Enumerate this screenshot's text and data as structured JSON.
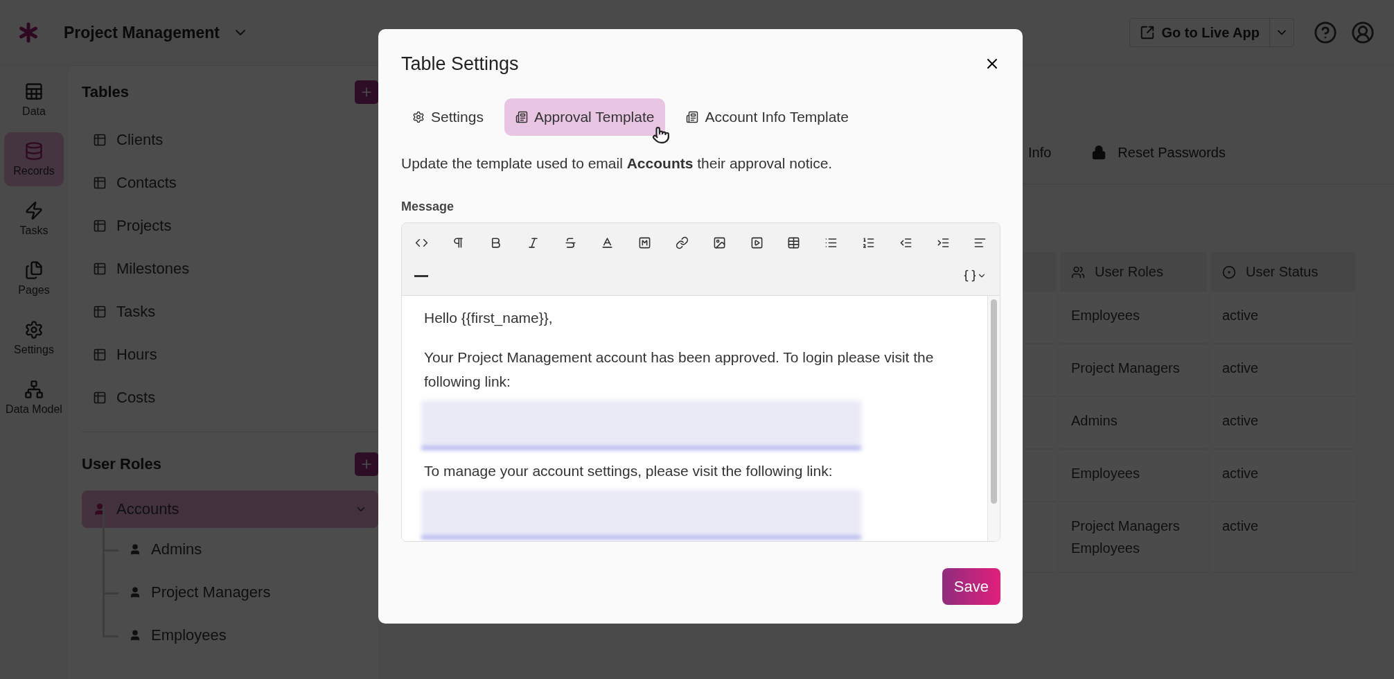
{
  "app": {
    "title": "Project Management"
  },
  "rail": [
    {
      "label": "Data",
      "selected": false
    },
    {
      "label": "Records",
      "selected": true
    },
    {
      "label": "Tasks",
      "selected": false
    },
    {
      "label": "Pages",
      "selected": false
    },
    {
      "label": "Settings",
      "selected": false
    },
    {
      "label": "Data Model",
      "selected": false
    }
  ],
  "header": {
    "live_app": "Go to Live App"
  },
  "tables_panel": {
    "title": "Tables",
    "items": [
      "Clients",
      "Contacts",
      "Projects",
      "Milestones",
      "Tasks",
      "Hours",
      "Costs"
    ]
  },
  "roles_panel": {
    "title": "User Roles",
    "roles": [
      {
        "label": "Accounts",
        "selected": true,
        "expanded": true,
        "children": [
          {
            "label": "Admins"
          },
          {
            "label": "Project Managers"
          },
          {
            "label": "Employees"
          }
        ]
      }
    ]
  },
  "main": {
    "tabs": [
      {
        "label": "Info",
        "kind": "plain"
      },
      {
        "label": "Reset Passwords",
        "kind": "lock"
      }
    ],
    "table": {
      "columns": [
        "User Roles",
        "User Status"
      ],
      "rows": [
        {
          "roles": [
            "Employees"
          ],
          "status": "active"
        },
        {
          "roles": [
            "Project Managers"
          ],
          "status": "active"
        },
        {
          "roles": [
            "Admins"
          ],
          "status": "active"
        },
        {
          "roles": [
            "Employees"
          ],
          "status": "active"
        },
        {
          "roles": [
            "Project Managers",
            "Employees"
          ],
          "status": "active"
        }
      ]
    }
  },
  "dialog": {
    "title": "Table Settings",
    "tabs": [
      {
        "label": "Settings",
        "kind": "settings",
        "selected": false
      },
      {
        "label": "Approval Template",
        "kind": "template",
        "selected": true
      },
      {
        "label": "Account Info Template",
        "kind": "template",
        "selected": false
      }
    ],
    "description": "Update the template used to email **Accounts** their approval notice.",
    "field_label": "Message",
    "editor": {
      "paragraphs": [
        {
          "kind": "text",
          "text": "Hello {{first_name}},"
        },
        {
          "kind": "text",
          "text": "Your Project Management account has been approved. To login please visit the following link:"
        },
        {
          "kind": "redacted"
        },
        {
          "kind": "text",
          "text": "To manage your account settings, please visit the following link:"
        },
        {
          "kind": "redacted"
        }
      ]
    },
    "save": "Save"
  }
}
